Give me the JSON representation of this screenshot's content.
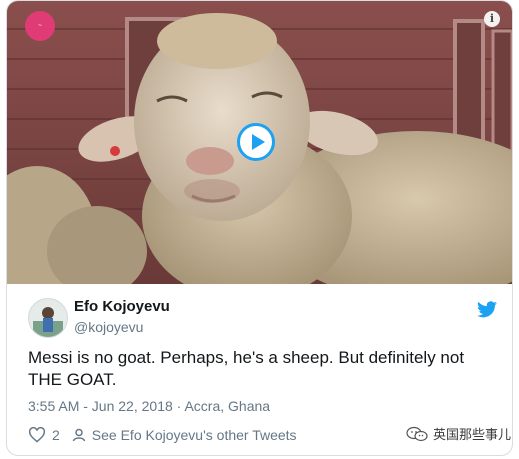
{
  "media": {
    "badge_text": "~",
    "info_icon": "info-icon",
    "play_icon": "play-icon"
  },
  "tweet": {
    "author_name": "Efo Kojoyevu",
    "author_handle": "@kojoyevu",
    "text": "Messi is no goat. Perhaps, he's a sheep. But definitely not THE GOAT.",
    "timestamp": "3:55 AM - Jun 22, 2018",
    "location": "Accra, Ghana",
    "separator": "·",
    "like_count": "2",
    "other_tweets_label": "See Efo Kojoyevu's other Tweets"
  },
  "watermark": {
    "text": "英国那些事儿"
  },
  "colors": {
    "twitter_blue": "#1da1f2",
    "muted": "#657786",
    "text": "#14171a"
  }
}
